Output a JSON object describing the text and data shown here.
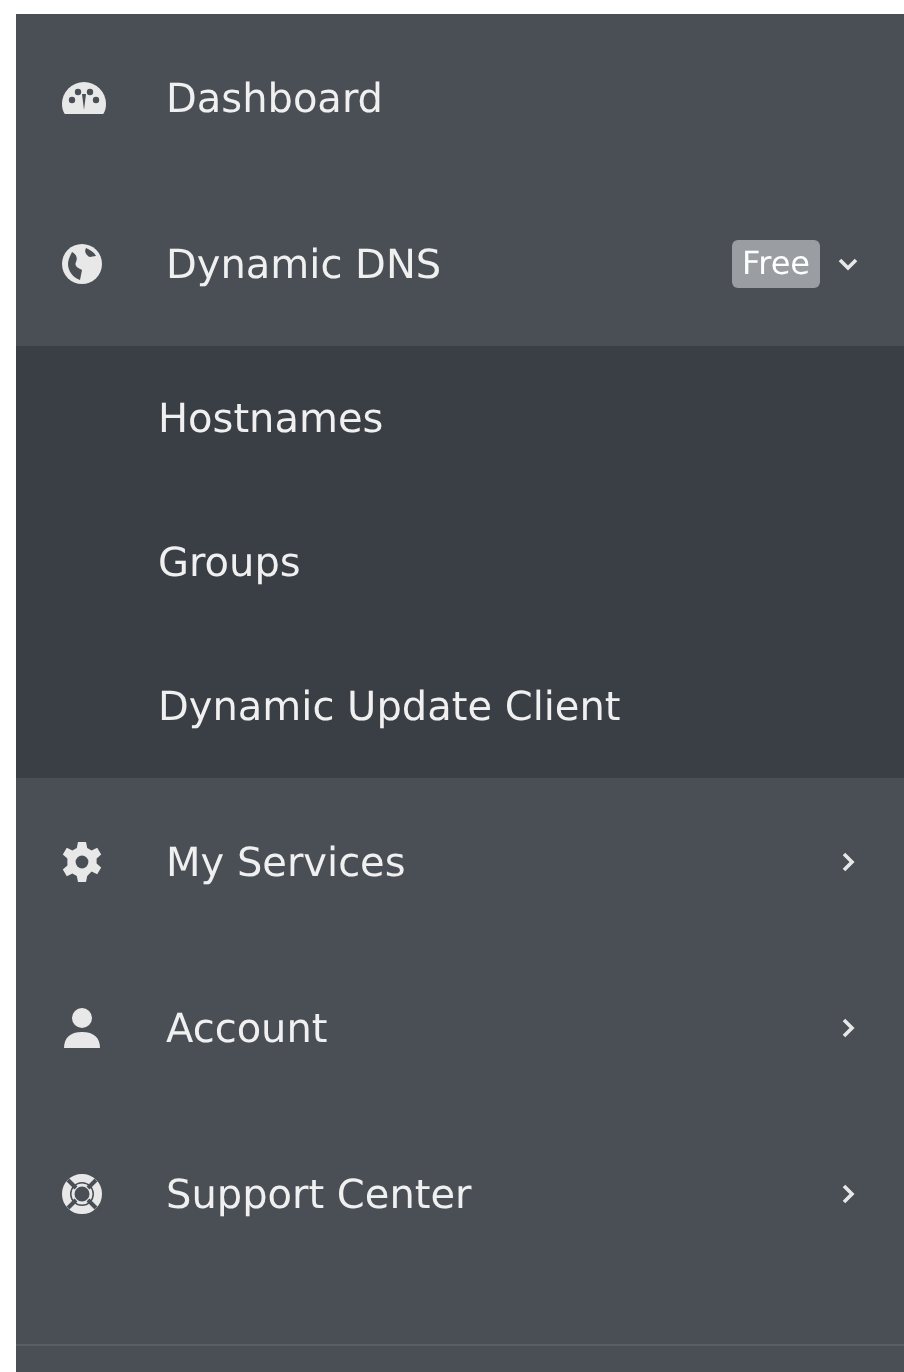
{
  "sidebar": {
    "items": [
      {
        "label": "Dashboard"
      },
      {
        "label": "Dynamic DNS",
        "badge": "Free",
        "expanded": true,
        "children": [
          {
            "label": "Hostnames"
          },
          {
            "label": "Groups"
          },
          {
            "label": "Dynamic Update Client"
          }
        ]
      },
      {
        "label": "My Services",
        "expanded": false
      },
      {
        "label": "Account",
        "expanded": false
      },
      {
        "label": "Support Center",
        "expanded": false
      }
    ]
  }
}
